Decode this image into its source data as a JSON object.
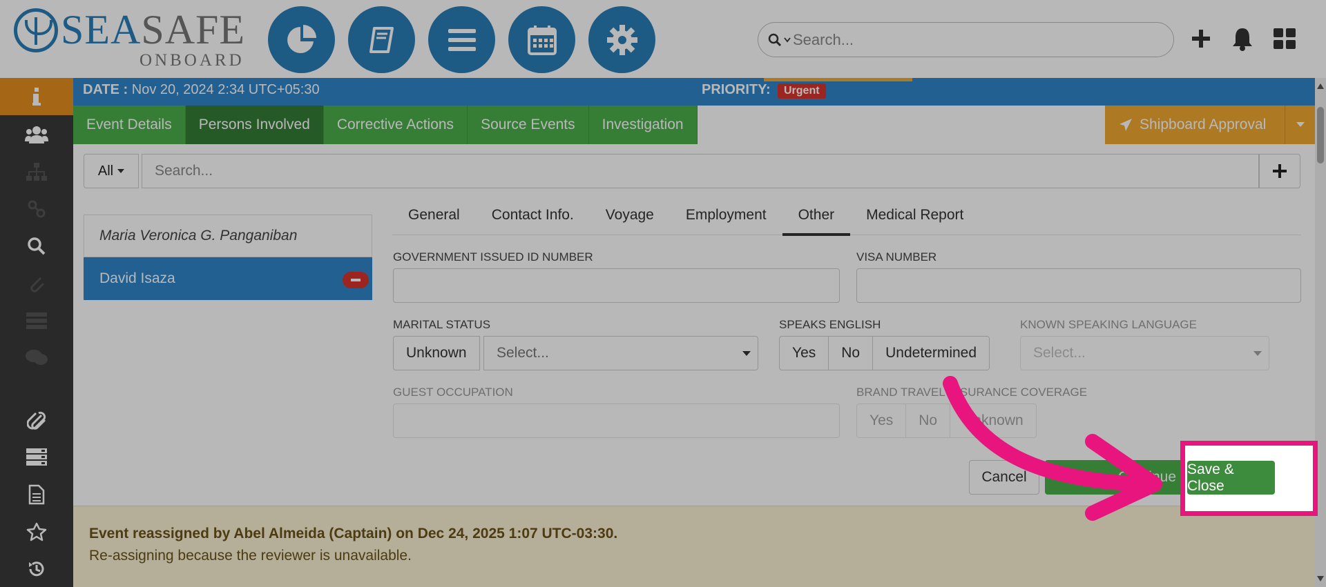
{
  "brand": {
    "word_left": "SEA",
    "word_right": "SAFE",
    "sub": "ONBOARD"
  },
  "header": {
    "search_placeholder": "Search...",
    "nav_icons": [
      "dashboard-pie-icon",
      "logbook-icon",
      "menu-list-icon",
      "calendar-icon",
      "settings-gear-icon"
    ],
    "right_icons": [
      "plus-icon",
      "bell-icon",
      "apps-grid-icon"
    ]
  },
  "sidebar": {
    "icons": [
      "info-icon",
      "users-icon",
      "org-chart-icon",
      "link-icon",
      "search-icon",
      "attachment-icon",
      "list-icon",
      "chat-icon",
      "paperclip-icon",
      "stack-icon",
      "document-icon",
      "star-icon",
      "history-icon"
    ]
  },
  "event": {
    "date_label": "DATE :",
    "date_value": "Nov 20, 2024 2:34 UTC+05:30",
    "priority_label": "PRIORITY:",
    "priority_value": "Urgent"
  },
  "tabs": [
    {
      "label": "Event Details",
      "active": false
    },
    {
      "label": "Persons Involved",
      "active": true
    },
    {
      "label": "Corrective Actions",
      "active": false
    },
    {
      "label": "Source Events",
      "active": false
    },
    {
      "label": "Investigation",
      "active": false
    }
  ],
  "approval_button": "Shipboard Approval",
  "filter": {
    "all_label": "All",
    "search_placeholder": "Search..."
  },
  "persons": [
    {
      "name": "Maria Veronica G. Panganiban",
      "selected": false
    },
    {
      "name": "David Isaza",
      "selected": true
    }
  ],
  "subtabs": [
    {
      "label": "General",
      "active": false
    },
    {
      "label": "Contact Info.",
      "active": false
    },
    {
      "label": "Voyage",
      "active": false
    },
    {
      "label": "Employment",
      "active": false
    },
    {
      "label": "Other",
      "active": true
    },
    {
      "label": "Medical Report",
      "active": false
    }
  ],
  "form": {
    "gov_id_label": "GOVERNMENT ISSUED ID NUMBER",
    "visa_label": "VISA NUMBER",
    "marital_label": "MARITAL STATUS",
    "marital_unknown": "Unknown",
    "marital_select": "Select...",
    "speaks_label": "SPEAKS ENGLISH",
    "speaks_options": [
      "Yes",
      "No",
      "Undetermined"
    ],
    "language_label": "KNOWN SPEAKING LANGUAGE",
    "language_select": "Select...",
    "occupation_label": "GUEST OCCUPATION",
    "insurance_label": "BRAND TRAVEL INSURANCE COVERAGE",
    "insurance_options": [
      "Yes",
      "No",
      "Unknown"
    ]
  },
  "actions": {
    "cancel": "Cancel",
    "continue": "Continue",
    "save_close": "Save & Close"
  },
  "notice": {
    "title": "Event reassigned by Abel Almeida (Captain) on Dec 24, 2025 1:07 UTC-03:30.",
    "body": "Re-assigning because the reviewer is unavailable."
  },
  "colors": {
    "brand_blue": "#2a7fb8",
    "tab_green": "#4cae4c",
    "approval_orange": "#f0a830",
    "highlight_pink": "#e8157f",
    "urgent_red": "#d9342b"
  }
}
